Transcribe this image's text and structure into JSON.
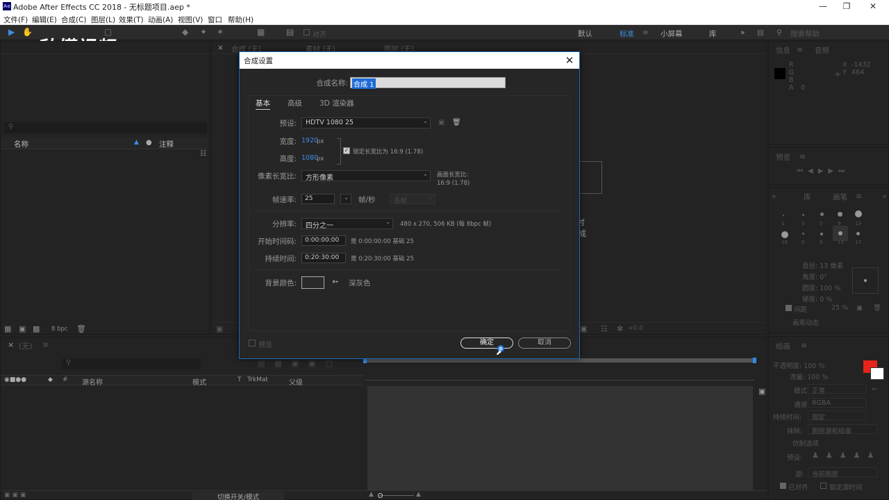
{
  "window": {
    "title": "Adobe After Effects CC 2018 - 无标题项目.aep *",
    "app_icon_text": "Ae"
  },
  "menu": [
    "文件(F)",
    "编辑(E)",
    "合成(C)",
    "图层(L)",
    "效果(T)",
    "动画(A)",
    "视图(V)",
    "窗口",
    "帮助(H)"
  ],
  "toolbar": {
    "snap_label": "对齐",
    "workspaces": [
      "默认",
      "标准",
      "小屏幕",
      "库"
    ],
    "search_placeholder": "搜索帮助"
  },
  "watermark": "秒懂视频",
  "project_panel": {
    "columns": [
      "名称",
      "注释"
    ],
    "footer_bpc": "8 bpc"
  },
  "comp_tabs": [
    "合成 (无)",
    "素材 (无)",
    "图层 (无)"
  ],
  "comp_viewer": {
    "hint_chars": [
      "时",
      "成"
    ],
    "zoom": "+0.0"
  },
  "info_panel": {
    "tabs": [
      "信息",
      "音频"
    ],
    "rgba_labels": [
      "R",
      "G",
      "B",
      "A"
    ],
    "a_value": "0",
    "x_value": "-1432",
    "y_value": "464"
  },
  "preview_panel": {
    "title": "预览"
  },
  "brush_panel": {
    "tabs": [
      "库",
      "画笔"
    ],
    "sizes": [
      "1",
      "3",
      "5",
      "9",
      "13",
      "19",
      "5",
      "9",
      "13",
      "17"
    ],
    "diameter": "直径: 13 像素",
    "angle": "角度: 0°",
    "roundness": "圆度: 100 %",
    "hardness": "硬度: 0 %",
    "spacing_label": "间距",
    "spacing_value": "25 %",
    "dynamics": "画笔动态"
  },
  "paint_panel": {
    "title": "绘画",
    "opacity": "不透明度: 100 %",
    "flow": "流量: 100 %",
    "mode_label": "模式:",
    "mode_value": "正常",
    "channel_label": "通道:",
    "channel_value": "RGBA",
    "duration_label": "持续时间:",
    "duration_value": "固定",
    "erase_label": "抹除:",
    "erase_value": "图层源和绘画",
    "clone_label": "仿制选项",
    "preset_label": "预设:",
    "source_label": "源:",
    "source_value": "当前图层",
    "aligned": "已对齐",
    "lock_time": "锁定源时间",
    "fg_color": "#e8231a",
    "bg_color": "#ffffff"
  },
  "timeline": {
    "tab": "(无)",
    "columns": [
      "源名称",
      "模式",
      "T",
      "TrkMat",
      "父级"
    ],
    "footer": "切换开关/模式"
  },
  "dialog": {
    "title": "合成设置",
    "name_label": "合成名称:",
    "name_value": "合成 1",
    "tabs": [
      "基本",
      "高级",
      "3D 渲染器"
    ],
    "preset_label": "预设:",
    "preset_value": "HDTV 1080 25",
    "width_label": "宽度:",
    "width_value": "1920",
    "height_label": "高度:",
    "height_value": "1080",
    "px": "px",
    "lock_label": "锁定长宽比为 16:9 (1.78)",
    "pixel_aspect_label": "像素长宽比:",
    "pixel_aspect_value": "方形像素",
    "frame_aspect_label": "画面长宽比:",
    "frame_aspect_value": "16:9 (1.78)",
    "frame_rate_label": "帧速率:",
    "frame_rate_value": "25",
    "fps_unit": "帧/秒",
    "drop_frame": "丢帧",
    "resolution_label": "分辨率:",
    "resolution_value": "四分之一",
    "resolution_info": "480 x 270, 506 KB (每 8bpc 帧)",
    "start_tc_label": "开始时间码:",
    "start_tc_value": "0:00:00:00",
    "start_tc_info": "是 0:00:00:00 基础 25",
    "duration_label": "持续时间:",
    "duration_value": "0:20:30:00",
    "duration_info": "是 0:20:30:00 基础 25",
    "bg_color_label": "背景颜色:",
    "bg_color_name": "深灰色",
    "preview_label": "预览",
    "ok_label": "确定",
    "cancel_label": "取消"
  }
}
